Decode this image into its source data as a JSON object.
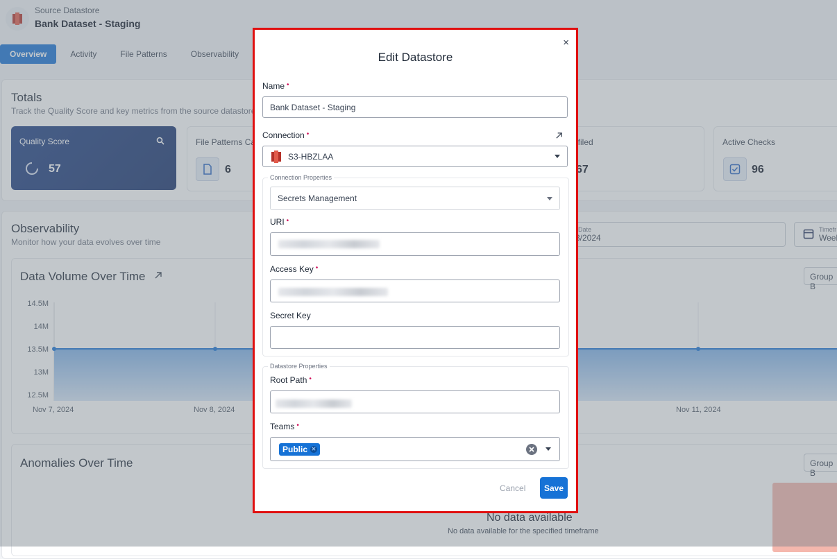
{
  "header": {
    "subtitle": "Source Datastore",
    "title": "Bank Dataset - Staging"
  },
  "tabs": [
    "Overview",
    "Activity",
    "File Patterns",
    "Observability"
  ],
  "totals": {
    "title": "Totals",
    "description": "Track the Quality Score and key metrics from the source datastore",
    "quality_label": "Quality Score",
    "quality_value": "57",
    "file_patterns_label": "File Patterns Ca",
    "file_patterns_value": "6",
    "profiled_label": "ofiled",
    "profiled_value": "67",
    "active_checks_label": "Active Checks",
    "active_checks_value": "96"
  },
  "observability": {
    "title": "Observability",
    "description": "Monitor how your data evolves over time",
    "date_label": "Date",
    "date_value": "3/2024",
    "timeframe_label": "Timefr",
    "timeframe_value": "Week"
  },
  "volume_chart": {
    "title": "Data Volume Over Time",
    "group_button": "Group B",
    "yticks": [
      "14.5M",
      "14M",
      "13.5M",
      "13M",
      "12.5M"
    ],
    "xticks": [
      "Nov 7, 2024",
      "Nov 8, 2024",
      "Nov 11, 2024"
    ]
  },
  "anomalies": {
    "title": "Anomalies Over Time",
    "group_button": "Group B",
    "empty_title": "No data available",
    "empty_sub": "No data available for the specified timeframe"
  },
  "modal": {
    "title": "Edit Datastore",
    "close": "×",
    "name_label": "Name",
    "name_value": "Bank Dataset - Staging",
    "connection_label": "Connection",
    "connection_value": "S3-HBZLAA",
    "connection_props_legend": "Connection Properties",
    "secrets_value": "Secrets Management",
    "uri_label": "URI",
    "access_key_label": "Access Key",
    "secret_key_label": "Secret Key",
    "datastore_props_legend": "Datastore Properties",
    "root_path_label": "Root Path",
    "teams_label": "Teams",
    "team_chip": "Public",
    "cancel": "Cancel",
    "save": "Save",
    "required_mark": "•"
  }
}
